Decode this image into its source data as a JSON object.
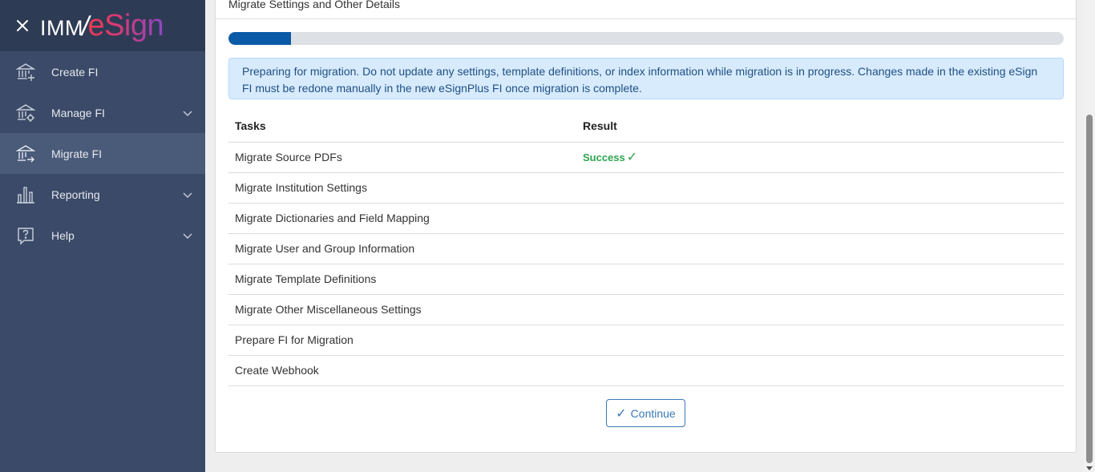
{
  "app": {
    "logo_text_imm": "IMM",
    "logo_text_slash": "/",
    "logo_text_esign": "eSign"
  },
  "sidebar": {
    "items": [
      {
        "label": "Create FI",
        "icon": "bank-plus-icon",
        "has_chevron": false,
        "active": false
      },
      {
        "label": "Manage FI",
        "icon": "bank-gear-icon",
        "has_chevron": true,
        "active": false
      },
      {
        "label": "Migrate FI",
        "icon": "bank-arrow-icon",
        "has_chevron": false,
        "active": true
      },
      {
        "label": "Reporting",
        "icon": "bar-chart-icon",
        "has_chevron": true,
        "active": false
      },
      {
        "label": "Help",
        "icon": "help-icon",
        "has_chevron": true,
        "active": false
      }
    ]
  },
  "main": {
    "card_title": "Migrate Settings and Other Details",
    "progress_fraction": 0.075,
    "alert_text": "Preparing for migration. Do not update any settings, template definitions, or index information while migration is in progress. Changes made in the existing eSign FI must be redone manually in the new eSignPlus FI once migration is complete.",
    "table": {
      "headers": {
        "task": "Tasks",
        "result": "Result"
      },
      "rows": [
        {
          "task": "Migrate Source PDFs",
          "result": "Success",
          "check": "✓"
        },
        {
          "task": "Migrate Institution Settings",
          "result": "",
          "check": ""
        },
        {
          "task": "Migrate Dictionaries and Field Mapping",
          "result": "",
          "check": ""
        },
        {
          "task": "Migrate User and Group Information",
          "result": "",
          "check": ""
        },
        {
          "task": "Migrate Template Definitions",
          "result": "",
          "check": ""
        },
        {
          "task": "Migrate Other Miscellaneous Settings",
          "result": "",
          "check": ""
        },
        {
          "task": "Prepare FI for Migration",
          "result": "",
          "check": ""
        },
        {
          "task": "Create Webhook",
          "result": "",
          "check": ""
        }
      ]
    },
    "continue_check": "✓",
    "continue_label": "Continue"
  },
  "colors": {
    "sidebar_bg": "#3b4a68",
    "sidebar_header_bg": "#2e3b55",
    "active_item_bg": "#4a5a79",
    "progress_fill": "#0b5aa8",
    "alert_bg": "#d7ebfd",
    "success": "#2ea44f",
    "button_accent": "#3b79b5"
  }
}
